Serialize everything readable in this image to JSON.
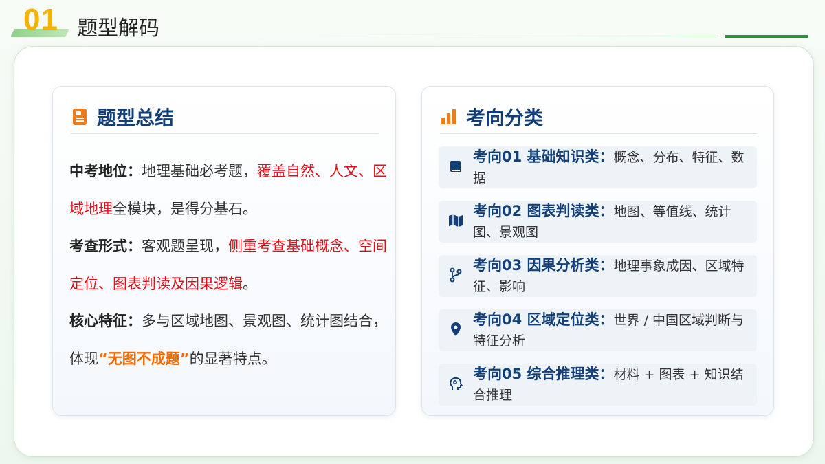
{
  "header": {
    "number": "01",
    "title": "题型解码"
  },
  "left_card": {
    "heading": "题型总结",
    "paragraphs": [
      {
        "label": "中考地位：",
        "text1": "地理基础必考题，",
        "highlight": "覆盖自然、人文、区域地理",
        "text2": "全模块，是得分基石。"
      },
      {
        "label": "考查形式：",
        "text1": "客观题呈现，",
        "highlight": "侧重考查基础概念、空间定位、图表判读及因果逻辑",
        "text2": "。"
      },
      {
        "label": "核心特征：",
        "text1": "多与区域地图、景观图、统计图结合，体现",
        "highlight": "“无图不成题”",
        "text2": "的显著特点。"
      }
    ]
  },
  "right_card": {
    "heading": "考向分类",
    "items": [
      {
        "label": "考向01 基础知识类：",
        "desc": "概念、分布、特征、数据",
        "icon": "book-icon"
      },
      {
        "label": "考向02 图表判读类：",
        "desc": "地图、等值线、统计图、景观图",
        "icon": "map-icon"
      },
      {
        "label": "考向03 因果分析类：",
        "desc": "地理事象成因、区域特征、影响",
        "icon": "branch-icon"
      },
      {
        "label": "考向04 区域定位类：",
        "desc": "世界 / 中国区域判断与特征分析",
        "icon": "location-pin-icon"
      },
      {
        "label": "考向05 综合推理类：",
        "desc": "材料 + 图表 + 知识结合推理",
        "icon": "brain-icon"
      }
    ]
  },
  "colors": {
    "accent_blue": "#123f78",
    "highlight_red": "#e0101a",
    "highlight_orange": "#f06a00",
    "number_yellow": "#f2b400",
    "green": "#2b8a3e"
  }
}
